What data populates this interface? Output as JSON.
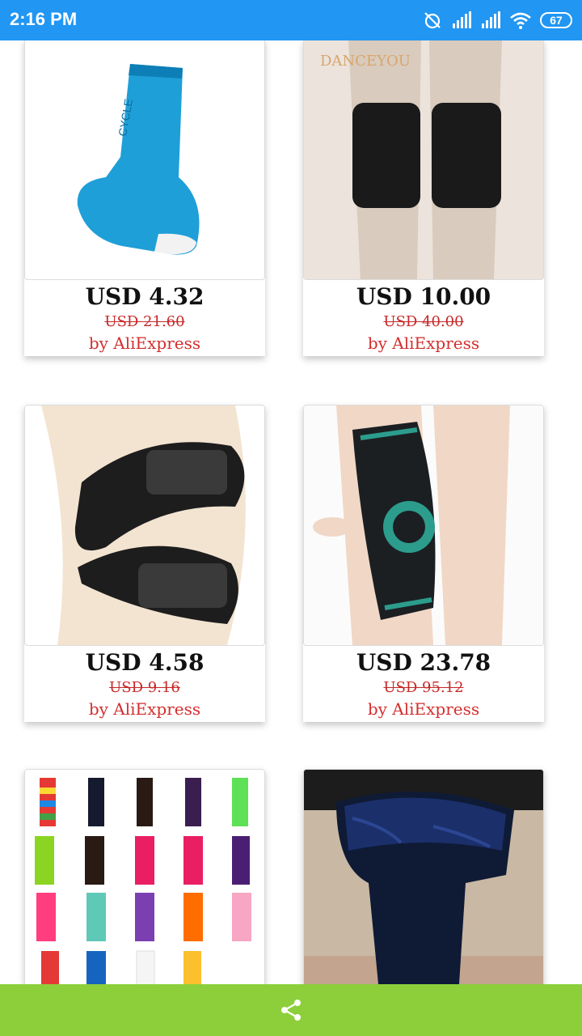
{
  "status": {
    "time": "2:16 PM",
    "battery": "67"
  },
  "products": [
    {
      "price": "USD 4.32",
      "old_price": "USD 21.60",
      "seller": "by AliExpress",
      "image": "blue-sock"
    },
    {
      "price": "USD 10.00",
      "old_price": "USD 40.00",
      "seller": "by AliExpress",
      "image": "black-knee-pads",
      "image_text": "DANCEYOU"
    },
    {
      "price": "USD 4.58",
      "old_price": "USD 9.16",
      "seller": "by AliExpress",
      "image": "patella-strap"
    },
    {
      "price": "USD 23.78",
      "old_price": "USD 95.12",
      "seller": "by AliExpress",
      "image": "knee-sleeve"
    },
    {
      "image": "leg-warmers-grid"
    },
    {
      "image": "fleece-leggings"
    }
  ],
  "colors": {
    "status_bar": "#2196f3",
    "bottom_bar": "#8ccf3a",
    "seller_text": "#d32f2f"
  },
  "bottom_bar": {
    "icon": "share-icon"
  }
}
